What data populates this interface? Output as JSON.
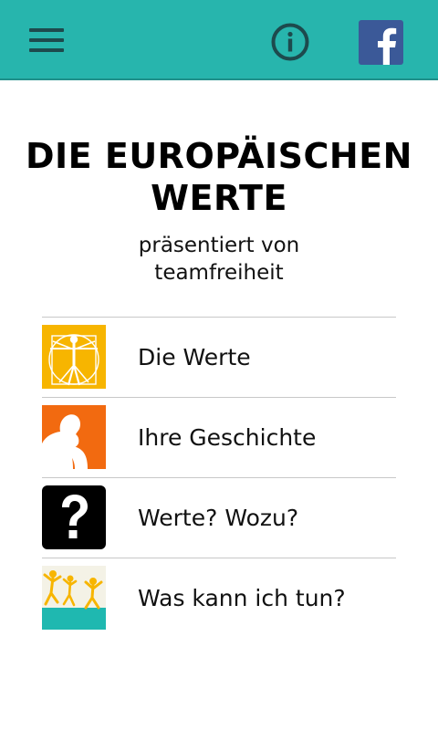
{
  "header": {
    "menu_icon": "hamburger-menu-icon",
    "info_icon": "info-circle-icon",
    "facebook_icon": "facebook-logo-icon",
    "bar_color": "#27b5ad",
    "icon_color": "#1d4a4d",
    "facebook_color": "#3b5998"
  },
  "title": {
    "line1": "DIE EUROPÄISCHEN",
    "line2": "WERTE",
    "subtitle_line1": "präsentiert von",
    "subtitle_line2": "teamfreiheit"
  },
  "menu": {
    "items": [
      {
        "label": "Die Werte",
        "icon": "vitruvian-man-icon",
        "color": "#f7b500"
      },
      {
        "label": "Ihre Geschichte",
        "icon": "thinker-icon",
        "color": "#f26a10"
      },
      {
        "label": "Werte? Wozu?",
        "icon": "question-mark-icon",
        "color": "#000000"
      },
      {
        "label": "Was kann ich tun?",
        "icon": "jumping-people-icon",
        "color": "#1fb8b0"
      }
    ]
  }
}
